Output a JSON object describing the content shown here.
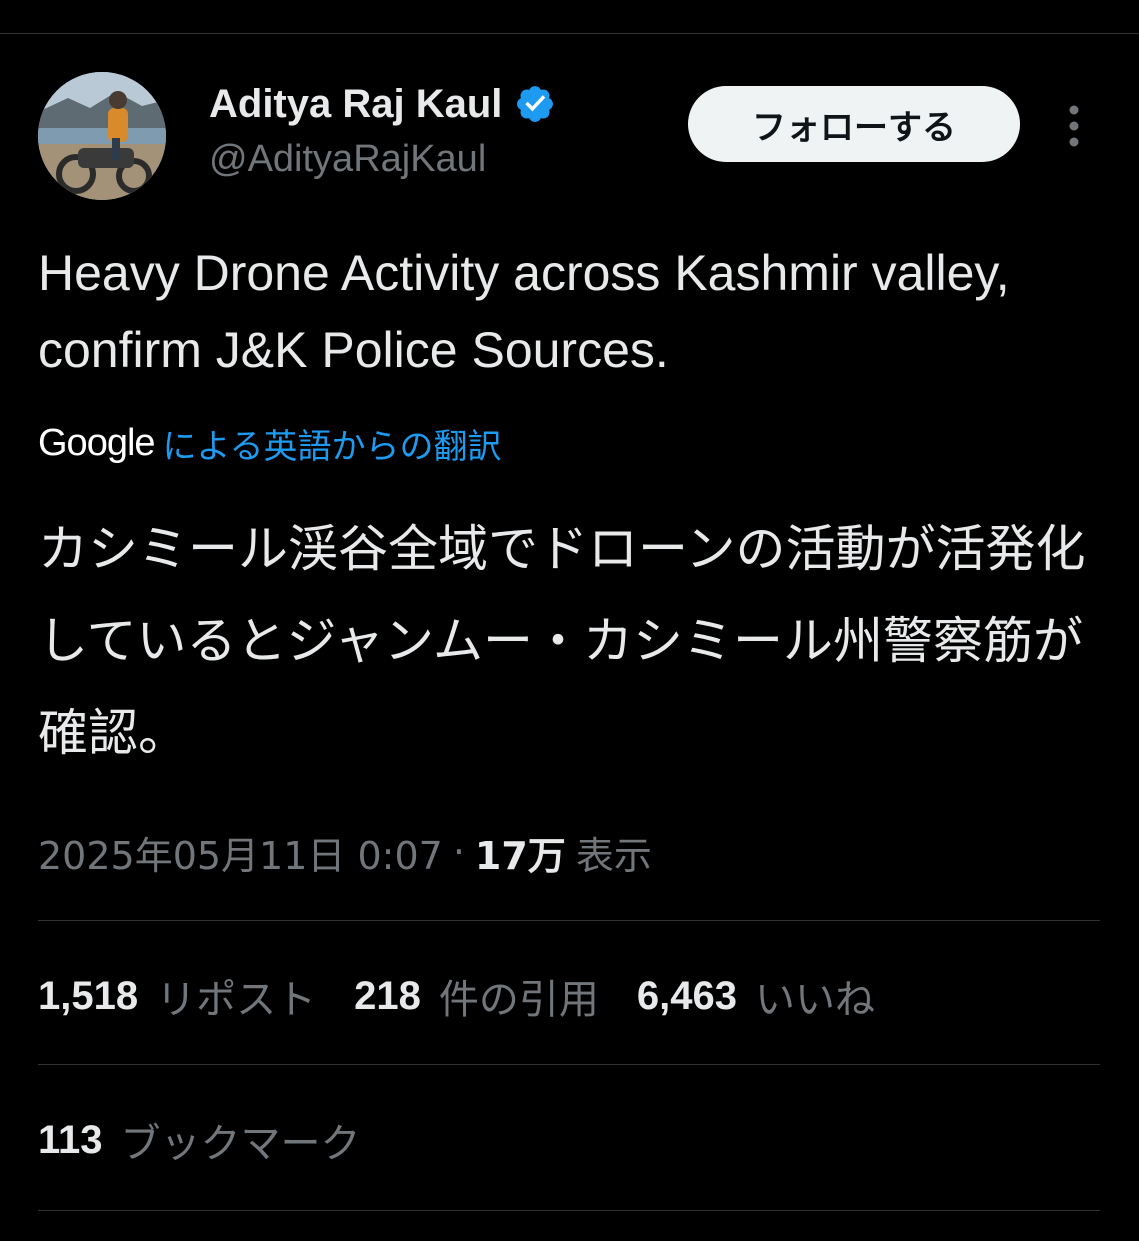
{
  "tweet": {
    "author": {
      "display_name": "Aditya Raj Kaul",
      "handle": "@AdityaRajKaul",
      "verified": true
    },
    "follow_label": "フォローする",
    "text": "Heavy Drone Activity across Kashmir valley, confirm J&K Police Sources.",
    "translation": {
      "brand": "Google",
      "link_label": "による英語からの翻訳",
      "text": "カシミール渓谷全域でドローンの活動が活発化しているとジャンムー・カシミール州警察筋が確認。"
    },
    "meta": {
      "timestamp": "2025年05月11日 0:07",
      "separator": "·",
      "views_count": "17万",
      "views_label": "表示"
    },
    "stats": {
      "reposts": {
        "count": "1,518",
        "label": "リポスト"
      },
      "quotes": {
        "count": "218",
        "label": "件の引用"
      },
      "likes": {
        "count": "6,463",
        "label": "いいね"
      },
      "bookmarks": {
        "count": "113",
        "label": "ブックマーク"
      }
    }
  },
  "icons": {
    "verified": "verified-badge-icon",
    "more": "more-vertical-icon"
  },
  "colors": {
    "background": "#000000",
    "text_primary": "#e7e9ea",
    "text_secondary": "#71767b",
    "accent_blue": "#1d9bf0",
    "divider": "#2f3336",
    "follow_button_bg": "#eff3f4"
  }
}
